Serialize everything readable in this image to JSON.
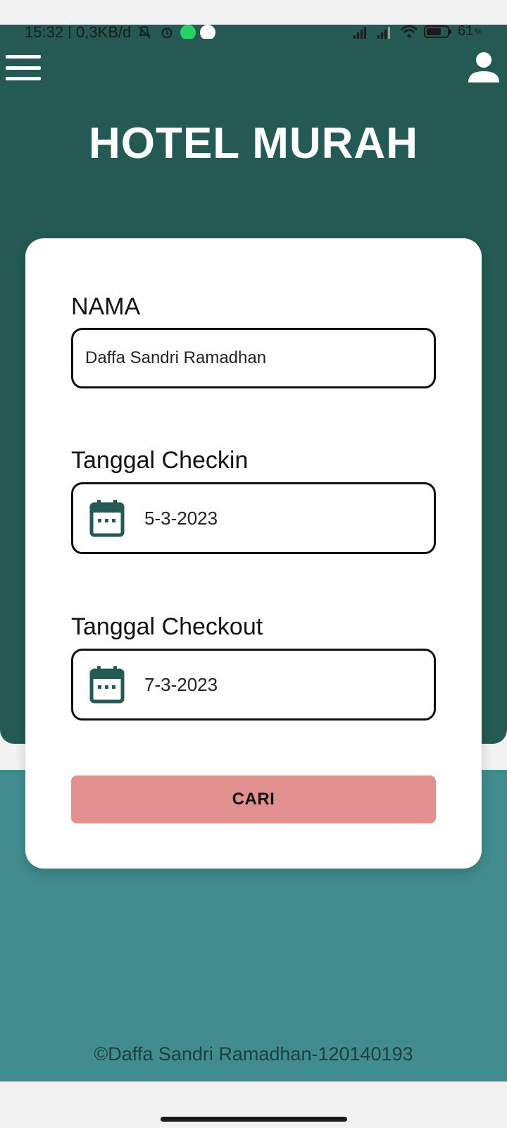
{
  "status_bar": {
    "time_and_speed": "15:32 | 0,3KB/d",
    "battery": "61",
    "battery_unit": "%"
  },
  "header": {
    "menu_icon": "hamburger-menu-icon",
    "profile_icon": "user-profile-icon",
    "title": "HOTEL MURAH"
  },
  "form": {
    "name": {
      "label": "NAMA",
      "value": "Daffa Sandri Ramadhan"
    },
    "checkin": {
      "label": "Tanggal Checkin",
      "value": "5-3-2023",
      "icon": "calendar-icon"
    },
    "checkout": {
      "label": "Tanggal Checkout",
      "value": "7-3-2023",
      "icon": "calendar-icon"
    },
    "submit_label": "CARI"
  },
  "footer": {
    "text": "©Daffa Sandri Ramadhan-120140193"
  },
  "colors": {
    "header_bg": "#255a54",
    "bottom_bg": "#418c8f",
    "button_bg": "#e29190",
    "icon_color": "#255a54"
  }
}
